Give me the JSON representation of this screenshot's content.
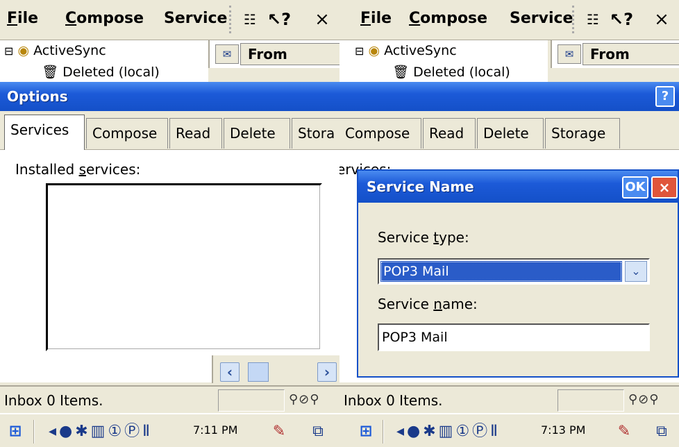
{
  "left": {
    "menu": {
      "file": "File",
      "compose": "Compose",
      "services": "Service"
    },
    "toolbar": {
      "close": "×",
      "help": "?"
    },
    "tree": {
      "root": "ActiveSync",
      "child": "Deleted (local)"
    },
    "list_columns": {
      "from": "From"
    },
    "options": {
      "title": "Options",
      "tabs": [
        "Services",
        "Compose",
        "Read",
        "Delete",
        "Stora"
      ],
      "installed_label": "Installed services:"
    },
    "status": {
      "text": "Inbox 0 Items."
    },
    "taskbar": {
      "clock": "7:11 PM"
    }
  },
  "right": {
    "menu": {
      "file": "File",
      "compose": "Compose",
      "services": "Service"
    },
    "toolbar": {
      "close": "×",
      "help": "?"
    },
    "tree": {
      "root": "ActiveSync",
      "child": "Deleted (local)"
    },
    "list_columns": {
      "from": "From"
    },
    "options": {
      "help": "?",
      "tabs": [
        "Compose",
        "Read",
        "Delete",
        "Storage"
      ],
      "installed_label_fragment": "ervices:"
    },
    "dialog": {
      "title": "Service Name",
      "ok": "OK",
      "close": "×",
      "service_type_label": "Service type:",
      "service_type_value": "POP3 Mail",
      "service_name_label": "Service name:",
      "service_name_value": "POP3 Mail"
    },
    "status": {
      "text": "Inbox 0 Items."
    },
    "taskbar": {
      "clock": "7:13 PM"
    }
  },
  "colors": {
    "titlebar": "#1c5ad8",
    "selection": "#2a5cc8",
    "chrome": "#ece9d8"
  }
}
